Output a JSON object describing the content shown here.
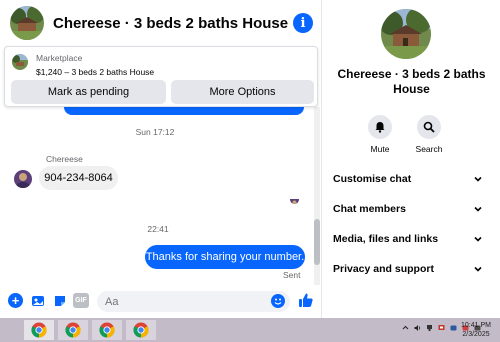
{
  "chat": {
    "title": "Chereese · 3 beds 2 baths House",
    "marketplace": {
      "label": "Marketplace",
      "listing": "$1,240 – 3 beds 2 baths House",
      "mark_pending_label": "Mark as pending",
      "more_options_label": "More Options"
    },
    "messages": {
      "timestamp_1": "Sun 17:12",
      "sender_name": "Chereese",
      "incoming_text": "904-234-8064",
      "timestamp_2": "22:41",
      "outgoing_text": "Thanks for sharing your number.",
      "status": "Sent"
    },
    "composer": {
      "placeholder": "Aa",
      "gif_label": "GIF"
    }
  },
  "side_panel": {
    "title": "Chereese · 3 beds 2 baths House",
    "actions": [
      {
        "label": "Mute",
        "icon": "bell-icon"
      },
      {
        "label": "Search",
        "icon": "search-icon"
      }
    ],
    "menu": [
      {
        "label": "Customise chat"
      },
      {
        "label": "Chat members"
      },
      {
        "label": "Media, files and links"
      },
      {
        "label": "Privacy and support"
      }
    ]
  },
  "taskbar": {
    "time": "10:41 PM",
    "date": "2/3/2025"
  },
  "colors": {
    "accent": "#0866ff",
    "button_bg": "#e4e6eb",
    "incoming_bubble": "#f0f0f0",
    "taskbar": "#c3bcc8"
  }
}
